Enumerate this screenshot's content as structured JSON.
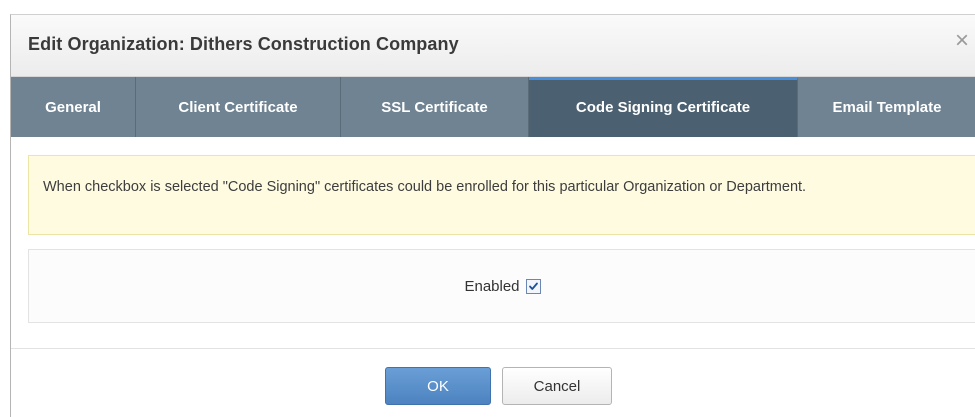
{
  "dialog": {
    "title": "Edit Organization: Dithers Construction Company",
    "close_icon": "×"
  },
  "tabs": [
    {
      "label": "General",
      "active": false
    },
    {
      "label": "Client Certificate",
      "active": false
    },
    {
      "label": "SSL Certificate",
      "active": false
    },
    {
      "label": "Code Signing Certificate",
      "active": true
    },
    {
      "label": "Email Template",
      "active": false
    }
  ],
  "notice": {
    "text": "When checkbox is selected \"Code Signing\" certificates could be enrolled for this particular Organization or Department."
  },
  "enabled": {
    "label": "Enabled",
    "checked": true
  },
  "buttons": {
    "ok_label": "OK",
    "cancel_label": "Cancel"
  },
  "colors": {
    "tab_bar": "#6f8393",
    "tab_active": "#4b6070",
    "tab_active_accent": "#4a8dd8",
    "notice_bg": "#fefbe1",
    "ok_button": "#5a90cc"
  }
}
